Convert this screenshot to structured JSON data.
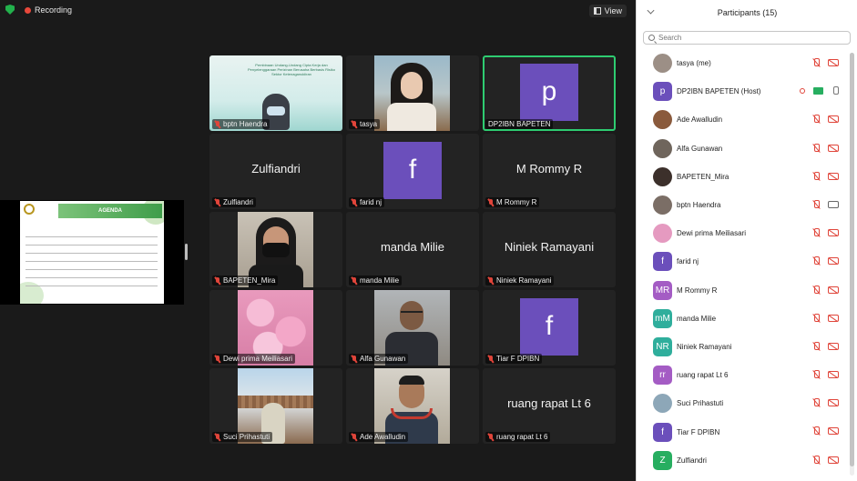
{
  "topbar": {
    "recording_label": "Recording",
    "view_label": "View"
  },
  "shared_screen": {
    "slide_title": "AGENDA"
  },
  "tiles": [
    {
      "name": "bptn Haendra",
      "kind": "photo",
      "photo": "banner",
      "banner_text": "Pembinaan Undang-Undang Cipta Kerja dan Penyelenggaraan Perizinan Berusaha Berbasis Risiko Sektor Ketenaganukliran",
      "active": false,
      "muted": true
    },
    {
      "name": "tasya",
      "kind": "photo",
      "photo": "tasya",
      "active": false,
      "muted": true
    },
    {
      "name": "DP2IBN BAPETEN",
      "kind": "avatar",
      "initial": "p",
      "active": true,
      "muted": false
    },
    {
      "name": "Zulfiandri",
      "kind": "text",
      "active": false,
      "muted": true
    },
    {
      "name": "farid nj",
      "kind": "avatar",
      "initial": "f",
      "active": false,
      "muted": true
    },
    {
      "name": "M Rommy R",
      "kind": "text",
      "active": false,
      "muted": true
    },
    {
      "name": "BAPETEN_Mira",
      "kind": "photo",
      "photo": "mira",
      "active": false,
      "muted": true
    },
    {
      "name": "manda Milie",
      "kind": "text",
      "active": false,
      "muted": true
    },
    {
      "name": "Niniek Ramayani",
      "kind": "text",
      "active": false,
      "muted": true
    },
    {
      "name": "Dewi prima Meiliasari",
      "kind": "photo",
      "photo": "sakura",
      "active": false,
      "muted": true
    },
    {
      "name": "Alfa Gunawan",
      "kind": "photo",
      "photo": "alfa",
      "active": false,
      "muted": true
    },
    {
      "name": "Tiar F DPIBN",
      "kind": "avatar",
      "initial": "f",
      "active": false,
      "muted": true
    },
    {
      "name": "Suci Prihastuti",
      "kind": "photo",
      "photo": "suci",
      "active": false,
      "muted": true
    },
    {
      "name": "Ade Awalludin",
      "kind": "photo",
      "photo": "awal",
      "active": false,
      "muted": true
    },
    {
      "name": "ruang rapat Lt 6",
      "kind": "text",
      "active": false,
      "muted": true
    }
  ],
  "participants_panel": {
    "title": "Participants (15)",
    "search_placeholder": "Search",
    "participants": [
      {
        "name": "tasya (me)",
        "avatar": "",
        "color": "#9c8f86",
        "mic": "off",
        "cam": "off"
      },
      {
        "name": "DP2IBN BAPETEN (Host)",
        "avatar": "p",
        "color": "#6b4fbb",
        "mic": "on",
        "cam": "none",
        "recording": true,
        "sharing": true
      },
      {
        "name": "Ade Awalludin",
        "avatar": "",
        "color": "#8a5a3c",
        "mic": "off",
        "cam": "off"
      },
      {
        "name": "Alfa Gunawan",
        "avatar": "",
        "color": "#6f655c",
        "mic": "off",
        "cam": "off"
      },
      {
        "name": "BAPETEN_Mira",
        "avatar": "",
        "color": "#3c302b",
        "mic": "off",
        "cam": "off"
      },
      {
        "name": "bptn Haendra",
        "avatar": "",
        "color": "#7b6e66",
        "mic": "off",
        "cam": "on"
      },
      {
        "name": "Dewi prima Meiliasari",
        "avatar": "",
        "color": "#e59ac0",
        "mic": "off",
        "cam": "off"
      },
      {
        "name": "farid nj",
        "avatar": "f",
        "color": "#6b4fbb",
        "mic": "off",
        "cam": "off"
      },
      {
        "name": "M Rommy R",
        "avatar": "MR",
        "color": "#a45cc4",
        "mic": "off",
        "cam": "off"
      },
      {
        "name": "manda Milie",
        "avatar": "mM",
        "color": "#2fae9c",
        "mic": "off",
        "cam": "off"
      },
      {
        "name": "Niniek Ramayani",
        "avatar": "NR",
        "color": "#2fae9c",
        "mic": "off",
        "cam": "off"
      },
      {
        "name": "ruang rapat Lt 6",
        "avatar": "rr",
        "color": "#a45cc4",
        "mic": "off",
        "cam": "off"
      },
      {
        "name": "Suci Prihastuti",
        "avatar": "",
        "color": "#8da7b8",
        "mic": "off",
        "cam": "off"
      },
      {
        "name": "Tiar F DPIBN",
        "avatar": "f",
        "color": "#6b4fbb",
        "mic": "off",
        "cam": "off"
      },
      {
        "name": "Zulfiandri",
        "avatar": "Z",
        "color": "#27ae60",
        "mic": "off",
        "cam": "off"
      }
    ]
  }
}
